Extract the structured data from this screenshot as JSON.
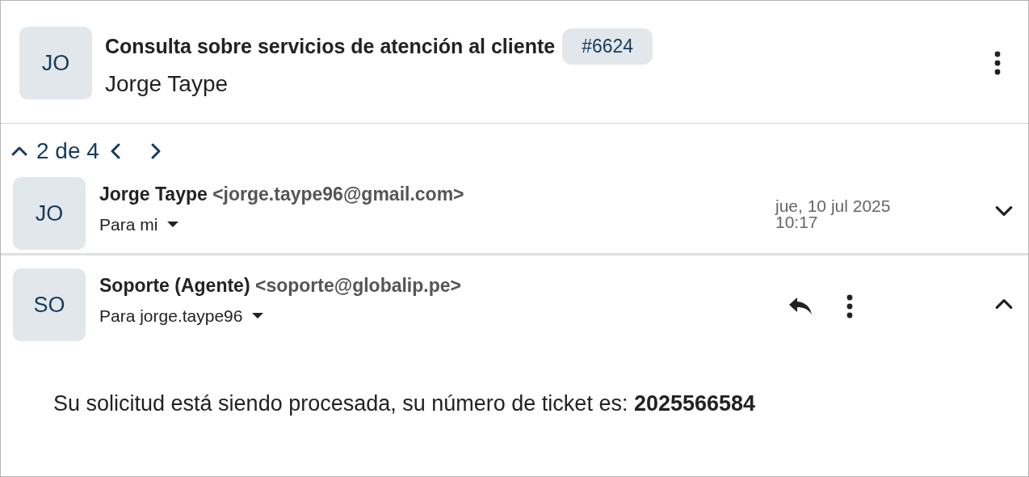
{
  "header": {
    "avatar": "JO",
    "title": "Consulta sobre servicios de atención al cliente",
    "ticket": "#6624",
    "requester": "Jorge Taype"
  },
  "navigation": {
    "position": "2 de 4"
  },
  "messages": [
    {
      "avatar": "JO",
      "sender": "Jorge Taype",
      "email": "<jorge.taype96@gmail.com>",
      "recipient": "Para mi",
      "date": "jue, 10 jul 2025",
      "time": "10:17",
      "expanded": false
    },
    {
      "avatar": "SO",
      "sender": "Soporte (Agente)",
      "email": "<soporte@globalip.pe>",
      "recipient": "Para jorge.taype96",
      "expanded": true,
      "body": "Su solicitud está siendo procesada, su número de ticket es: **2025566584**"
    }
  ]
}
